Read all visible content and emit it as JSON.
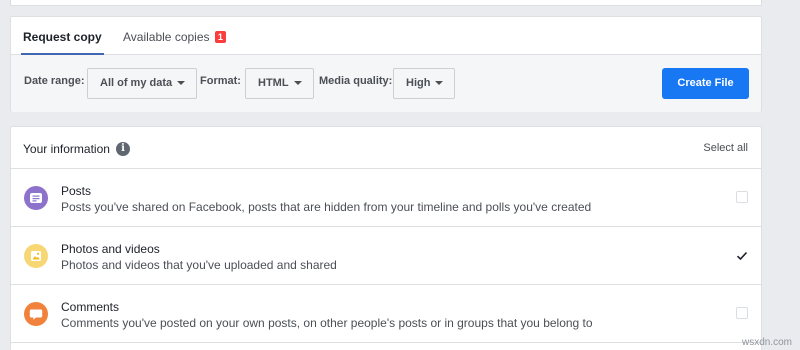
{
  "tabs": {
    "request_copy": "Request copy",
    "available_copies": "Available copies",
    "available_badge": "1"
  },
  "controls": {
    "date_range_label": "Date range:",
    "date_range_value": "All of my data",
    "format_label": "Format:",
    "format_value": "HTML",
    "media_quality_label": "Media quality:",
    "media_quality_value": "High",
    "create_button": "Create File"
  },
  "info": {
    "title": "Your information",
    "info_icon_glyph": "i",
    "select_all": "Select all",
    "items": [
      {
        "title": "Posts",
        "description": "Posts you've shared on Facebook, posts that are hidden from your timeline and polls you've created",
        "checked": false,
        "icon": "posts-icon",
        "color": "#8c72cb"
      },
      {
        "title": "Photos and videos",
        "description": "Photos and videos that you've uploaded and shared",
        "checked": true,
        "icon": "photos-icon",
        "color": "#f7d774"
      },
      {
        "title": "Comments",
        "description": "Comments you've posted on your own posts, on other people's posts or in groups that you belong to",
        "checked": false,
        "icon": "comments-icon",
        "color": "#f0823c"
      }
    ]
  },
  "watermark": "wsxdn.com",
  "colors": {
    "accent": "#1877f2",
    "tab_underline": "#4267b2",
    "badge": "#fa3e3e"
  }
}
